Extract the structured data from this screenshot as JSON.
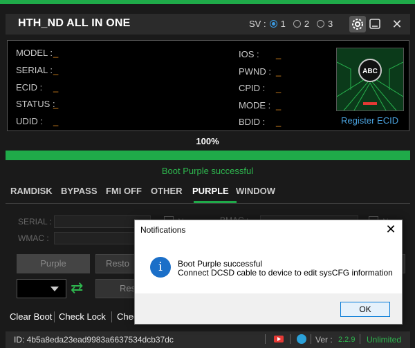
{
  "app": {
    "title": "HTH_ND ALL IN ONE",
    "sv_label": "SV :",
    "sv_options": [
      "1",
      "2",
      "3"
    ],
    "sv_selected": "1"
  },
  "device_info": {
    "left": [
      {
        "label": "MODEL :",
        "value": "_"
      },
      {
        "label": "SERIAL :",
        "value": "_"
      },
      {
        "label": "ECID :",
        "value": "_"
      },
      {
        "label": "STATUS :",
        "value": "_"
      },
      {
        "label": "UDID :",
        "value": "_"
      }
    ],
    "right": [
      {
        "label": "IOS :",
        "value": "_"
      },
      {
        "label": "PWND :",
        "value": "_"
      },
      {
        "label": "CPID :",
        "value": "_"
      },
      {
        "label": "MODE :",
        "value": "_"
      },
      {
        "label": "BDID :",
        "value": "_"
      }
    ],
    "logo_text": "ABC",
    "register_link": "Register ECID"
  },
  "progress": {
    "percent_label": "100%",
    "value": 1.0,
    "status": "Boot Purple successful"
  },
  "tabs": {
    "items": [
      "RAMDISK",
      "BYPASS",
      "FMI OFF",
      "OTHER",
      "PURPLE",
      "WINDOW"
    ],
    "active": "PURPLE"
  },
  "purple": {
    "serial_label": "SERIAL :",
    "wmac_label": "WMAC :",
    "bmac_label": "BMAC :",
    "no_label": "No",
    "purple_button": "Purple",
    "restore_button": "Resto",
    "reset_button": "Res"
  },
  "bottom_actions": [
    "Clear Boot",
    "Check Lock",
    "Chec"
  ],
  "footer": {
    "id_text": "ID: 4b5a8eda23ead9983a6637534dcb37dc",
    "ver_label": "Ver :",
    "ver_value": "2.2.9",
    "license": "Unlimited"
  },
  "dialog": {
    "title": "Notifications",
    "message_line1": "Boot Purple successful",
    "message_line2": "Connect DCSD cable to device to edit sysCFG information",
    "ok_button": "OK"
  },
  "colors": {
    "accent": "#1faa49",
    "link": "#4aa3e0",
    "value": "#e08a20"
  }
}
